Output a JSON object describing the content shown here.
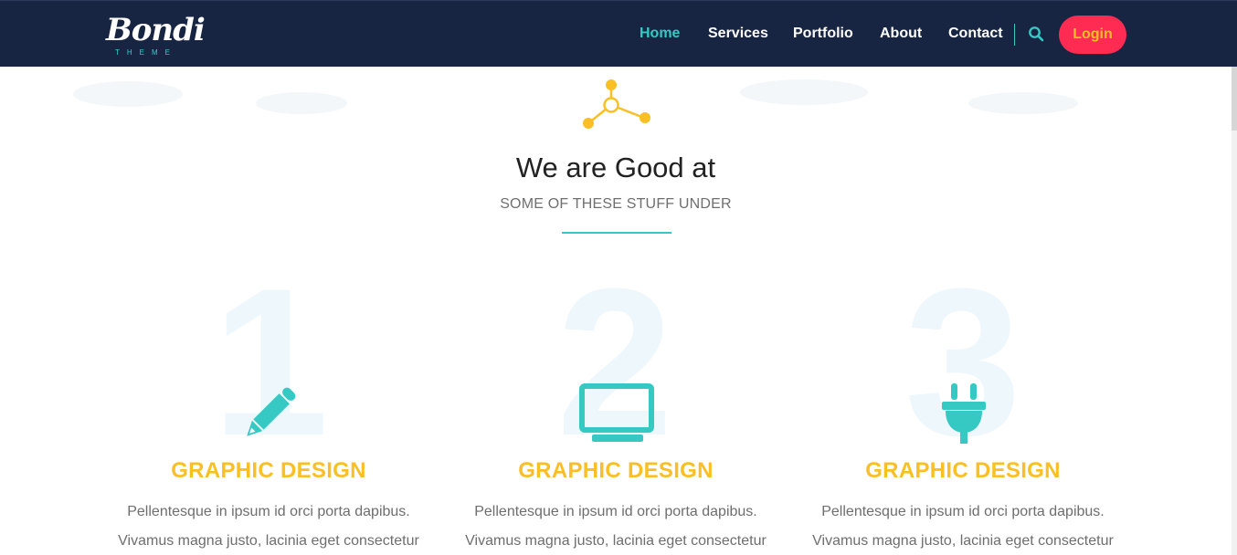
{
  "brand": {
    "name": "Bondi",
    "sub": "THEME"
  },
  "nav": {
    "items": [
      {
        "label": "Home",
        "active": true
      },
      {
        "label": "Services",
        "active": false
      },
      {
        "label": "Portfolio",
        "active": false
      },
      {
        "label": "About",
        "active": false
      },
      {
        "label": "Contact",
        "active": false
      }
    ],
    "login_label": "Login"
  },
  "section": {
    "title": "We are Good at",
    "subtitle": "SOME OF THESE STUFF UNDER"
  },
  "services": [
    {
      "number": "1",
      "icon": "pencil-icon",
      "title": "GRAPHIC DESIGN",
      "line1": "Pellentesque in ipsum id orci porta dapibus.",
      "line2": "Vivamus magna justo, lacinia eget consectetur"
    },
    {
      "number": "2",
      "icon": "monitor-icon",
      "title": "GRAPHIC DESIGN",
      "line1": "Pellentesque in ipsum id orci porta dapibus.",
      "line2": "Vivamus magna justo, lacinia eget consectetur"
    },
    {
      "number": "3",
      "icon": "plug-icon",
      "title": "GRAPHIC DESIGN",
      "line1": "Pellentesque in ipsum id orci porta dapibus.",
      "line2": "Vivamus magna justo, lacinia eget consectetur"
    }
  ],
  "colors": {
    "nav_bg": "#182542",
    "accent": "#36c9c4",
    "yellow": "#fbbf26",
    "login_bg": "#ff2b52"
  }
}
